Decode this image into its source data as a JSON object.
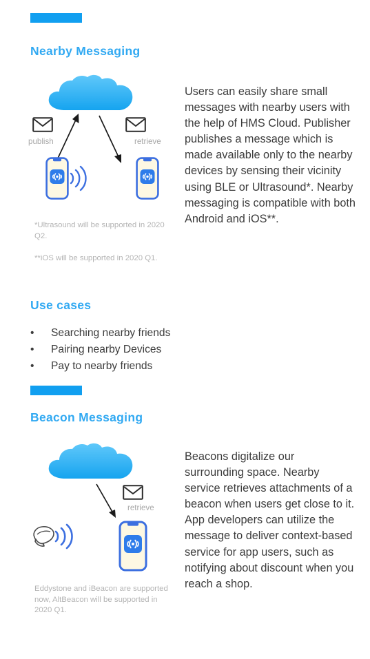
{
  "theme": {
    "accent_bar_color": "#119FF0",
    "heading_color": "#31A9F2",
    "body_text_color": "#3C3C3C",
    "footnote_color": "#B4B4B4",
    "cloud_color_top": "#56C2F7",
    "cloud_color_bottom": "#1FA9F0",
    "phone_screen_color": "#2E7CEA",
    "phone_body_color": "#FDF8E3",
    "wave_color": "#3C6FE0",
    "background": "#FFFFFF"
  },
  "sections": {
    "nearby": {
      "heading": "Nearby Messaging",
      "paragraph": "Users can easily share small messages with nearby users with the help of HMS Cloud. Publisher publishes a message which is made available only to the nearby devices by sensing their vicinity using BLE or Ultrasound*. Nearby messaging  is compatible with both Android and iOS**.",
      "diagram": {
        "publish_label": "publish",
        "retrieve_label": "retrieve",
        "cloud_name": "hms-cloud",
        "left_device_name": "publisher-phone",
        "right_device_name": "subscriber-phone"
      },
      "footnotes": [
        "*Ultrasound will be supported in 2020  Q2.",
        "**iOS will be supported in 2020  Q1."
      ]
    },
    "use_cases": {
      "heading": "Use cases",
      "items": [
        "Searching nearby friends",
        "Pairing nearby Devices",
        "Pay to nearby friends"
      ],
      "bullet_glyph": "•"
    },
    "beacon": {
      "heading": "Beacon Messaging",
      "paragraph": "Beacons digitalize our surrounding space. Nearby service retrieves attachments of a beacon when users get close to it. App developers can utilize the message to deliver context-based service for app users, such as notifying about discount when you reach a shop.",
      "diagram": {
        "retrieve_label": "retrieve",
        "cloud_name": "hms-cloud",
        "beacon_device_name": "beacon-transmitter",
        "phone_name": "receiver-phone"
      },
      "footnote": "Eddystone and iBeacon are supported now, AltBeacon will be supported in 2020  Q1."
    }
  }
}
